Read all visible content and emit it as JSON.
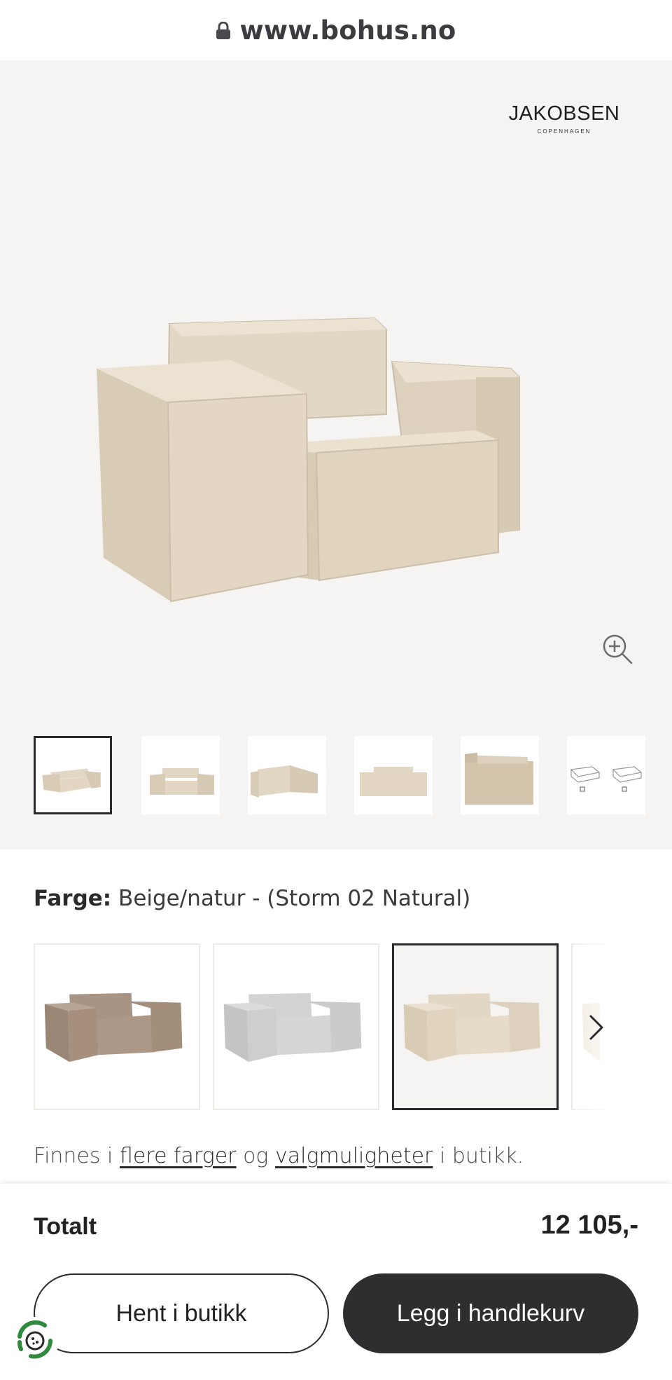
{
  "browser": {
    "url": "www.bohus.no",
    "lock_icon": "lock-icon"
  },
  "gallery": {
    "brand_name": "JAKOBSEN",
    "brand_sub": "COPENHAGEN",
    "zoom_icon": "zoom-in-icon",
    "thumbnails": [
      {
        "view": "front-angle",
        "active": true
      },
      {
        "view": "front-angle-2",
        "active": false
      },
      {
        "view": "side-angle",
        "active": false
      },
      {
        "view": "front",
        "active": false
      },
      {
        "view": "side",
        "active": false
      },
      {
        "view": "diagram",
        "active": false
      }
    ]
  },
  "color": {
    "label": "Farge:",
    "value": "Beige/natur - (Storm 02 Natural)",
    "swatches": [
      {
        "name": "brown",
        "color": "#a89484",
        "selected": false
      },
      {
        "name": "grey",
        "color": "#cfcfcf",
        "selected": false
      },
      {
        "name": "beige",
        "color": "#ddd1bd",
        "selected": true
      }
    ],
    "next_icon": "chevron-right-icon"
  },
  "availability": {
    "prefix": "Finnes i",
    "link1": "flere farger",
    "middle": "og",
    "link2": "valgmuligheter",
    "suffix": "i butikk."
  },
  "checkout": {
    "total_label": "Totalt",
    "total_price": "12 105,-",
    "pickup_button": "Hent i butikk",
    "cart_button": "Legg i handlekurv"
  },
  "colors": {
    "primary_dark": "#2e2e31",
    "gallery_bg": "#f5f4f2"
  }
}
